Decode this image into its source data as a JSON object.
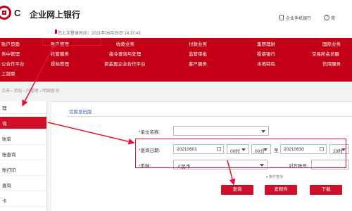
{
  "header": {
    "brand_short": "C",
    "brand_name": "企业网上银行",
    "welcome": "您上次登录时间：2021年06月25日 14:37:43",
    "mobile_bank": "企业手机银行",
    "faq_label": "常",
    "faq_icon_char": "?"
  },
  "nav": {
    "row1": [
      "账户页面",
      "账户管理",
      "收款业务",
      "付款业务",
      "集团理财",
      "国际业务"
    ],
    "row2": [
      "务中管理",
      "托管服务",
      "指令查询与处理",
      "监管审批",
      "投资银行",
      "交易所会员服"
    ],
    "row3": [
      "公合作平台",
      "投标管理",
      "资金属企业合作平台",
      "客户服务",
      "本地特色",
      "信用服务"
    ],
    "row4": [
      "工银聚"
    ]
  },
  "breadcrumb": "点击 › 添加 › 户管理 › 明细查询",
  "sidebar": {
    "items": [
      "理",
      "询",
      "账单",
      "账查询",
      "账打印",
      "查询",
      "卡",
      "",
      ""
    ]
  },
  "main": {
    "switch_link": "切换至旧版",
    "unit_label": "单位名称:",
    "unit_value": "",
    "date_label": "查询日期:",
    "date_start": "20210601",
    "hour_start": "00时",
    "minute_start": "00分",
    "to": "至",
    "date_end": "20210630",
    "hour_end": "23时",
    "currency_label": "币种:",
    "currency_value": "人民币",
    "counter_label": "对方账号:",
    "more_label": "条件查询",
    "buttons": {
      "query": "查询",
      "send_mail": "发邮件",
      "download": "下载"
    }
  },
  "colors": {
    "brand_red": "#c40017",
    "annotation_red": "#e8103a"
  }
}
